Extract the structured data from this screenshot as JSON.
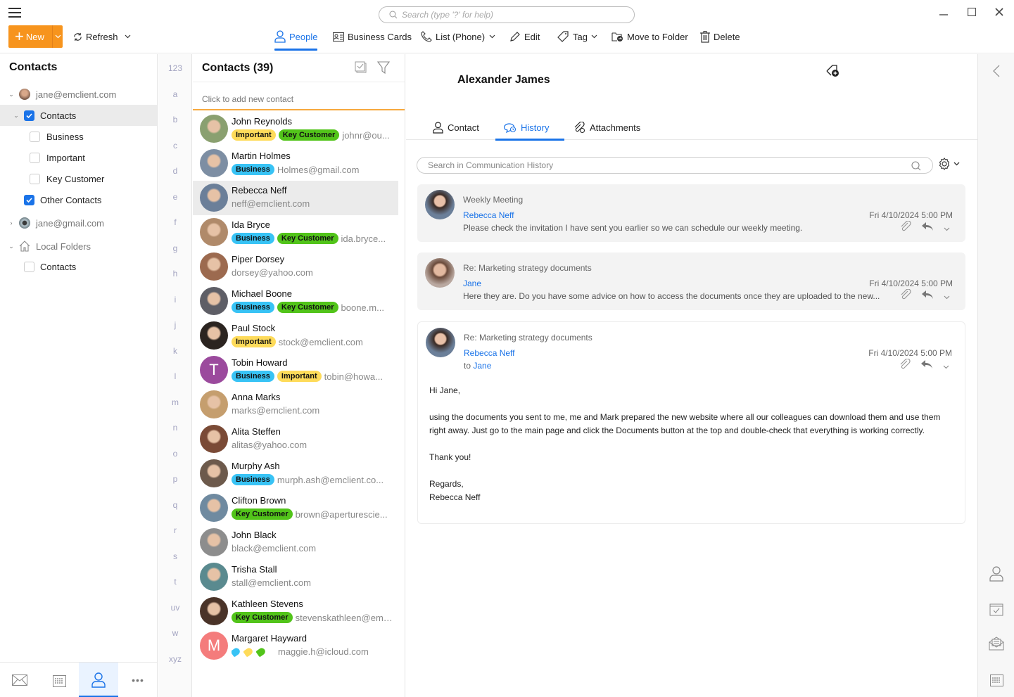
{
  "titlebar": {
    "search_placeholder": "Search (type '?' for help)",
    "minimize": "minimize",
    "maximize": "maximize",
    "close": "close"
  },
  "toolbar": {
    "new_label": "New",
    "refresh_label": "Refresh",
    "people_label": "People",
    "business_cards_label": "Business Cards",
    "list_label": "List (Phone)",
    "edit_label": "Edit",
    "tag_label": "Tag",
    "move_label": "Move to Folder",
    "delete_label": "Delete"
  },
  "sidebar": {
    "title": "Contacts",
    "tree": [
      {
        "label": "jane@emclient.com",
        "type": "account",
        "expanded": true
      },
      {
        "label": "Contacts",
        "type": "folder",
        "checked": true,
        "selected": true,
        "expanded": true
      },
      {
        "label": "Business",
        "type": "subfolder",
        "checked": false
      },
      {
        "label": "Important",
        "type": "subfolder",
        "checked": false
      },
      {
        "label": "Key Customer",
        "type": "subfolder",
        "checked": false
      },
      {
        "label": "Other Contacts",
        "type": "folder",
        "checked": true
      },
      {
        "label": "jane@gmail.com",
        "type": "account",
        "expanded": false
      },
      {
        "label": "Local Folders",
        "type": "local",
        "expanded": true
      },
      {
        "label": "Contacts",
        "type": "folder",
        "checked": false
      }
    ],
    "bottom_nav": [
      "mail",
      "calendar",
      "contacts",
      "more"
    ]
  },
  "alphabet": [
    "123",
    "a",
    "b",
    "c",
    "d",
    "e",
    "f",
    "g",
    "h",
    "i",
    "j",
    "k",
    "l",
    "m",
    "n",
    "o",
    "p",
    "q",
    "r",
    "s",
    "t",
    "uv",
    "w",
    "xyz"
  ],
  "contact_list": {
    "title": "Contacts (39)",
    "add_placeholder": "Click to add new contact",
    "contacts": [
      {
        "name": "John Reynolds",
        "tags": [
          "Important",
          "Key Customer"
        ],
        "email": "johnr@ou...",
        "avatar_color": "#8aa070"
      },
      {
        "name": "Martin Holmes",
        "tags": [
          "Business"
        ],
        "email": "Holmes@gmail.com",
        "avatar_color": "#7d8ea3"
      },
      {
        "name": "Rebecca Neff",
        "tags": [],
        "email": "neff@emclient.com",
        "avatar_color": "#6b7f99",
        "selected": true
      },
      {
        "name": "Ida Bryce",
        "tags": [
          "Business",
          "Key Customer"
        ],
        "email": "ida.bryce...",
        "avatar_color": "#b08a6a"
      },
      {
        "name": "Piper Dorsey",
        "tags": [],
        "email": "dorsey@yahoo.com",
        "avatar_color": "#9c6a4f"
      },
      {
        "name": "Michael Boone",
        "tags": [
          "Business",
          "Key Customer"
        ],
        "email": "boone.m...",
        "avatar_color": "#5e5e66"
      },
      {
        "name": "Paul Stock",
        "tags": [
          "Important"
        ],
        "email": "stock@emclient.com",
        "avatar_color": "#2b2420"
      },
      {
        "name": "Tobin Howard",
        "tags": [
          "Business",
          "Important"
        ],
        "email": "tobin@howa...",
        "avatar_color": "#9b4a9d",
        "initial": "T"
      },
      {
        "name": "Anna Marks",
        "tags": [],
        "email": "marks@emclient.com",
        "avatar_color": "#c59e6e"
      },
      {
        "name": "Alita Steffen",
        "tags": [],
        "email": "alitas@yahoo.com",
        "avatar_color": "#7a4a36"
      },
      {
        "name": "Murphy Ash",
        "tags": [
          "Business"
        ],
        "email": "murph.ash@emclient.co...",
        "avatar_color": "#6d5a4c"
      },
      {
        "name": "Clifton Brown",
        "tags": [
          "Key Customer"
        ],
        "email": "brown@aperturescie...",
        "avatar_color": "#6f8aa0"
      },
      {
        "name": "John Black",
        "tags": [],
        "email": "black@emclient.com",
        "avatar_color": "#8d8d8d"
      },
      {
        "name": "Trisha Stall",
        "tags": [],
        "email": "stall@emclient.com",
        "avatar_color": "#5a8a8f"
      },
      {
        "name": "Kathleen Stevens",
        "tags": [
          "Key Customer"
        ],
        "email": "stevenskathleen@emcl...",
        "avatar_color": "#4a3328"
      },
      {
        "name": "Margaret Hayward",
        "tags": [],
        "mini_tags": [
          "#38c3f5",
          "#fedb5a",
          "#52c41a"
        ],
        "email": "maggie.h@icloud.com",
        "avatar_color": "#f47c7c",
        "initial": "M"
      }
    ]
  },
  "detail": {
    "name": "Alexander James",
    "tabs": [
      {
        "label": "Contact",
        "active": false
      },
      {
        "label": "History",
        "active": true
      },
      {
        "label": "Attachments",
        "active": false
      }
    ],
    "history_search_placeholder": "Search in Communication History",
    "messages": [
      {
        "subject": "Weekly Meeting",
        "from": "Rebecca Neff",
        "date": "Fri 4/10/2024 5:00 PM",
        "preview": "Please check the invitation I have sent you earlier so we can schedule our weekly meeting.",
        "expanded": false
      },
      {
        "subject": "Re: Marketing strategy documents",
        "from": "Jane",
        "date": "Fri 4/10/2024 5:00 PM",
        "preview": "Here they are. Do you have some advice on how to access the documents once they are uploaded to the new...",
        "expanded": false
      },
      {
        "subject": "Re: Marketing strategy documents",
        "from": "Rebecca Neff",
        "to_prefix": "to",
        "to": "Jane",
        "date": "Fri 4/10/2024 5:00 PM",
        "expanded": true,
        "body": [
          "Hi Jane,",
          "using the documents you sent to me, me and Mark prepared the new website where all our colleagues can download them and use them right away. Just go to the main page and click the Documents button at the top and double-check that everything is working correctly.",
          "Thank you!",
          "Regards,\nRebecca Neff"
        ]
      }
    ]
  },
  "colors": {
    "accent": "#1a73e8",
    "new_button": "#f7941d",
    "tag_business": "#38c3f5",
    "tag_important": "#fedb5a",
    "tag_key_customer": "#52c41a"
  }
}
